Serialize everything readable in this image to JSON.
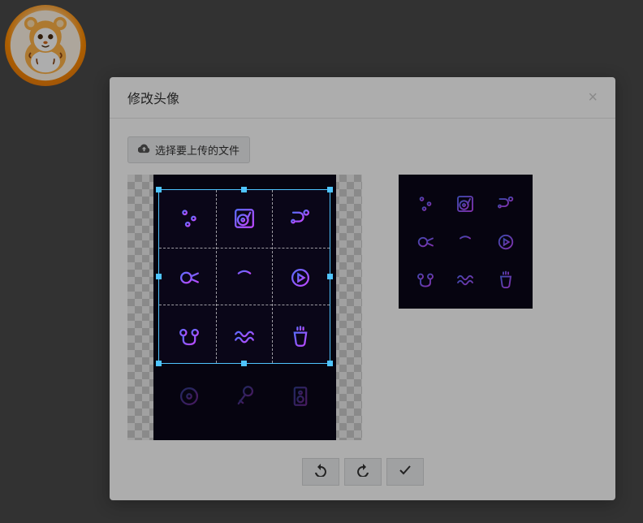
{
  "modal": {
    "title": "修改头像",
    "close_label": "×"
  },
  "upload": {
    "button_label": "选择要上传的文件"
  },
  "toolbar": {
    "rotate_left": "↺",
    "rotate_right": "↻",
    "confirm": "✓"
  },
  "colors": {
    "selection": "#4fc4ff",
    "grad_start": "#6a5acd",
    "grad_end": "#b048ff"
  },
  "icons_grid": [
    "sliders-icon",
    "turntable-icon",
    "flow-icon",
    "horn-icon",
    "shower-icon",
    "play-circle-icon",
    "earbuds-icon",
    "wave-icon",
    "cup-icon",
    "disc-icon",
    "microphone-icon",
    "speaker-icon"
  ],
  "preview_icons": [
    "sliders-icon",
    "turntable-icon",
    "flow-icon",
    "horn-icon",
    "shower-icon",
    "play-circle-icon",
    "earbuds-icon",
    "wave-icon",
    "cup-icon"
  ]
}
